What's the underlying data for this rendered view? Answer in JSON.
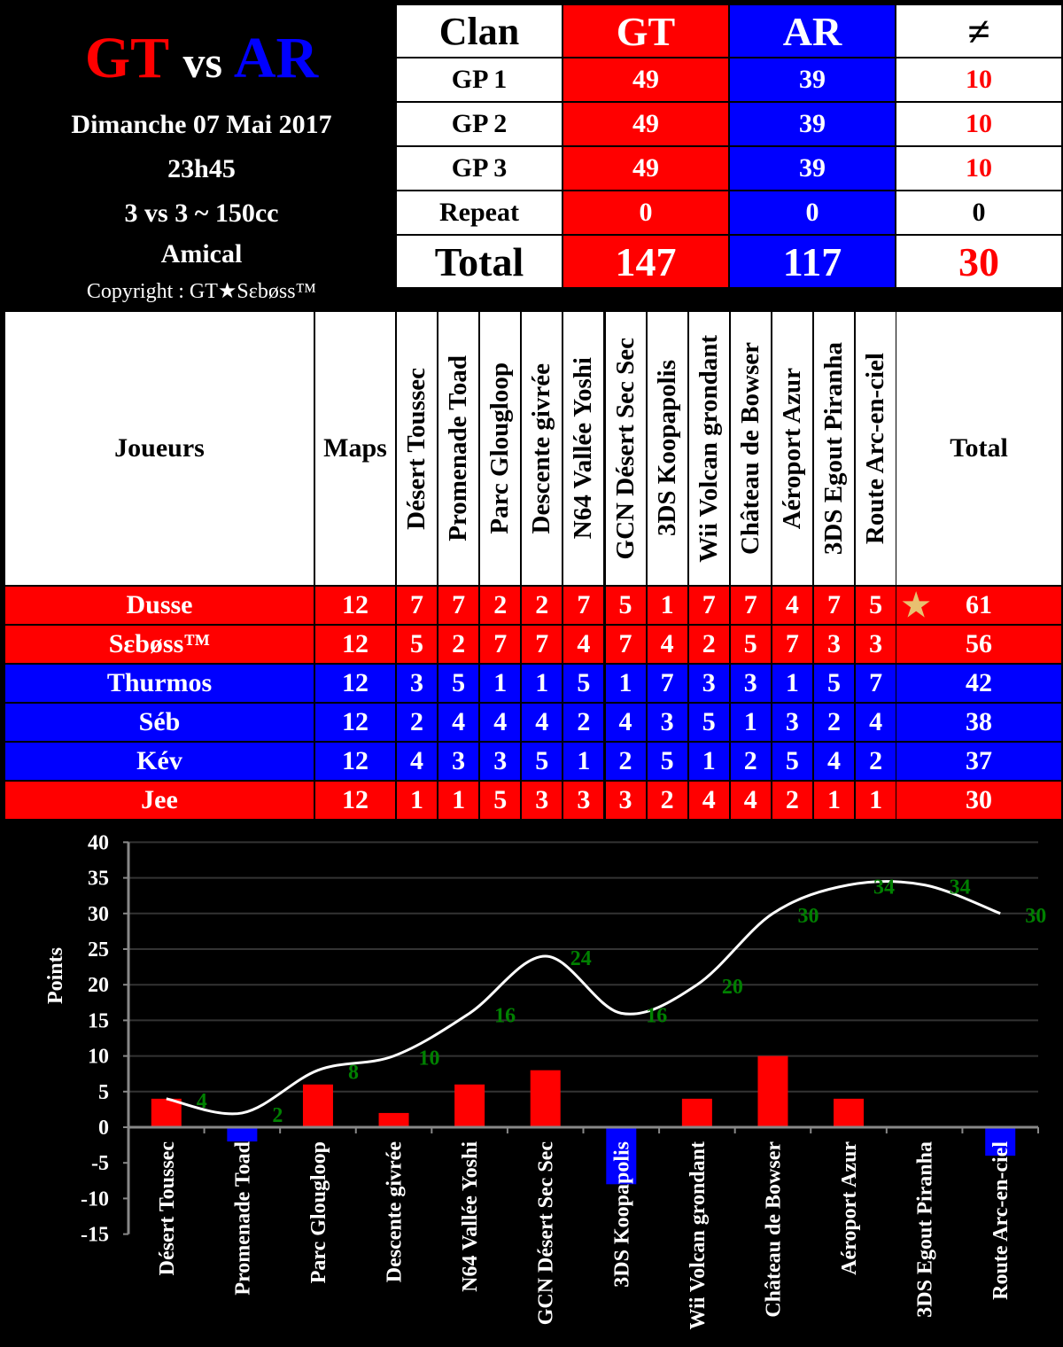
{
  "header": {
    "team1": "GT",
    "vs": "vs",
    "team2": "AR",
    "date": "Dimanche 07 Mai 2017",
    "time": "23h45",
    "format": "3 vs 3 ~ 150cc",
    "type": "Amical",
    "copyright": "Copyright : GT★Sεbøss™"
  },
  "score": {
    "headers": [
      "Clan",
      "GT",
      "AR",
      "≠"
    ],
    "rows": [
      [
        "GP 1",
        "49",
        "39",
        "10"
      ],
      [
        "GP 2",
        "49",
        "39",
        "10"
      ],
      [
        "GP 3",
        "49",
        "39",
        "10"
      ],
      [
        "Repeat",
        "0",
        "0",
        "0"
      ]
    ],
    "total": [
      "Total",
      "147",
      "117",
      "30"
    ]
  },
  "players": {
    "headers": {
      "players": "Joueurs",
      "maps": "Maps",
      "total": "Total"
    },
    "tracks": [
      "Désert Toussec",
      "Promenade Toad",
      "Parc Glougloop",
      "Descente givrée",
      "N64 Vallée Yoshi",
      "GCN Désert Sec Sec",
      "3DS Koopapolis",
      "Wii Volcan grondant",
      "Château de Bowser",
      "Aéroport Azur",
      "3DS Egout Piranha",
      "Route Arc-en-ciel"
    ],
    "rows": [
      {
        "name": "Dusse",
        "team": "GT",
        "maps": "12",
        "scores": [
          "7",
          "7",
          "2",
          "2",
          "7",
          "5",
          "1",
          "7",
          "7",
          "4",
          "7",
          "5"
        ],
        "total": "61",
        "star": true
      },
      {
        "name": "Sεbøss™",
        "team": "GT",
        "maps": "12",
        "scores": [
          "5",
          "2",
          "7",
          "7",
          "4",
          "7",
          "4",
          "2",
          "5",
          "7",
          "3",
          "3"
        ],
        "total": "56"
      },
      {
        "name": "Thurmos",
        "team": "AR",
        "maps": "12",
        "scores": [
          "3",
          "5",
          "1",
          "1",
          "5",
          "1",
          "7",
          "3",
          "3",
          "1",
          "5",
          "7"
        ],
        "total": "42"
      },
      {
        "name": "Séb",
        "team": "AR",
        "maps": "12",
        "scores": [
          "2",
          "4",
          "4",
          "4",
          "2",
          "4",
          "3",
          "5",
          "1",
          "3",
          "2",
          "4"
        ],
        "total": "38"
      },
      {
        "name": "Kév",
        "team": "AR",
        "maps": "12",
        "scores": [
          "4",
          "3",
          "3",
          "5",
          "1",
          "2",
          "5",
          "1",
          "2",
          "5",
          "4",
          "2"
        ],
        "total": "37"
      },
      {
        "name": "Jee",
        "team": "GT",
        "maps": "12",
        "scores": [
          "1",
          "1",
          "5",
          "3",
          "3",
          "3",
          "2",
          "4",
          "4",
          "2",
          "1",
          "1"
        ],
        "total": "30"
      }
    ]
  },
  "colors": {
    "GT": "#ff0000",
    "AR": "#0000ff",
    "label": "#008000",
    "line": "#ffffff",
    "grid": "#333333"
  },
  "chart_data": {
    "type": "bar+line",
    "ylabel": "Points",
    "ylim": [
      -15,
      40
    ],
    "yticks": [
      -15,
      -10,
      -5,
      0,
      5,
      10,
      15,
      20,
      25,
      30,
      35,
      40
    ],
    "grid": true,
    "categories": [
      "Désert Toussec",
      "Promenade Toad",
      "Parc Glougloop",
      "Descente givrée",
      "N64 Vallée Yoshi",
      "GCN Désert Sec Sec",
      "3DS Koopapolis",
      "Wii Volcan grondant",
      "Château de Bowser",
      "Aéroport Azur",
      "3DS Egout Piranha",
      "Route Arc-en-ciel"
    ],
    "bar_values": [
      4,
      -2,
      6,
      2,
      6,
      8,
      -8,
      4,
      10,
      4,
      0,
      -4
    ],
    "line_values": [
      4,
      2,
      8,
      10,
      16,
      24,
      16,
      20,
      30,
      34,
      34,
      30
    ]
  }
}
